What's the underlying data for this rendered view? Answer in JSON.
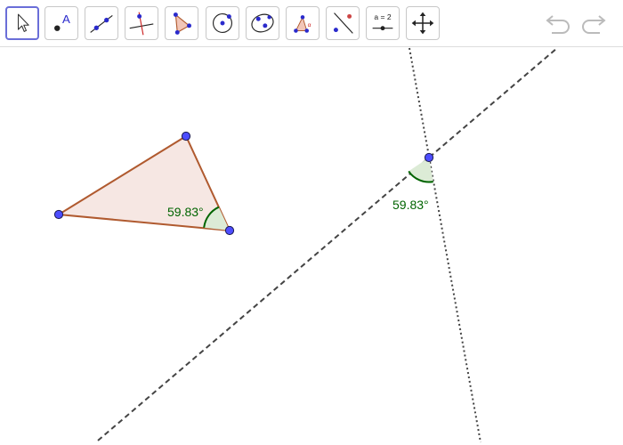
{
  "toolbar": {
    "tools": [
      {
        "name": "move",
        "selected": true
      },
      {
        "name": "point"
      },
      {
        "name": "line"
      },
      {
        "name": "perpendicular-line"
      },
      {
        "name": "polygon"
      },
      {
        "name": "circle-center-point"
      },
      {
        "name": "conic"
      },
      {
        "name": "angle"
      },
      {
        "name": "reflect-about-line"
      },
      {
        "name": "slider",
        "label": "a = 2"
      },
      {
        "name": "move-graphics-view"
      }
    ],
    "undo_icon": "undo-icon",
    "redo_icon": "redo-icon"
  },
  "drawing": {
    "angle_triangle_label": "59.83°",
    "angle_lines_label": "59.83°"
  },
  "colors": {
    "triangle_edge": "#b05a2f",
    "triangle_fill": "#f6e7e3",
    "point_fill": "#4d4dff",
    "angle": "#006400",
    "selected_tool_border": "#6a6ed8"
  }
}
